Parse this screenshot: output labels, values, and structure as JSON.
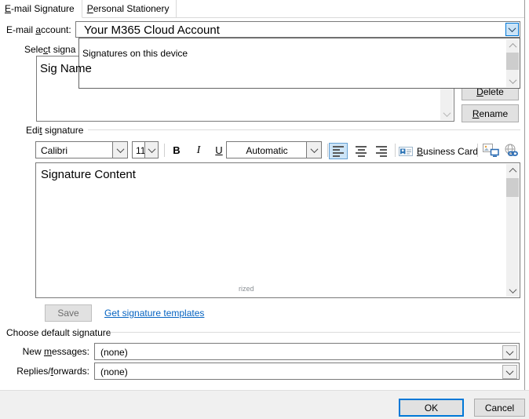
{
  "tabs": [
    {
      "pre": "",
      "key": "E",
      "post": "-mail Signature"
    },
    {
      "pre": "",
      "key": "P",
      "post": "ersonal Stationery"
    }
  ],
  "account": {
    "label_pre": "E-mail ",
    "label_key": "a",
    "label_post": "ccount:",
    "value": "Your M365 Cloud Account",
    "dropdown_item": "Signatures on this device"
  },
  "signature_list": {
    "label_pre": "Sele",
    "label_key": "c",
    "label_post": "t signa",
    "item": "Sig Name"
  },
  "side_buttons": {
    "delete_pre": "",
    "delete_key": "D",
    "delete_post": "elete",
    "rename_pre": "",
    "rename_key": "R",
    "rename_post": "ename"
  },
  "edit_signature": {
    "label_pre": "Edi",
    "label_key": "t",
    "label_post": " signature",
    "font_name": "Calibri",
    "font_size": "11",
    "bold": "B",
    "italic": "I",
    "underline": "U",
    "font_color": "Automatic",
    "business_card_pre": "",
    "business_card_key": "B",
    "business_card_post": "usiness Card",
    "content": "Signature Content",
    "watermark": "rized",
    "save": "Save",
    "templates_link": "Get signature templates"
  },
  "defaults": {
    "label": "Choose default signature",
    "new_messages_pre": "New ",
    "new_messages_key": "m",
    "new_messages_post": "essages:",
    "new_messages_value": "(none)",
    "replies_pre": "Replies/",
    "replies_key": "f",
    "replies_post": "orwards:",
    "replies_value": "(none)"
  },
  "footer": {
    "ok": "OK",
    "cancel": "Cancel"
  },
  "colors": {
    "accent": "#0078d7",
    "selection_fill": "#cce4f7",
    "link": "#0563c1",
    "button_face": "#e1e1e1",
    "footer_bg": "#f0f0f0"
  },
  "icons": {
    "combo_button": "chevron-down-icon",
    "alignment": [
      "align-left-icon",
      "align-center-icon",
      "align-right-icon"
    ],
    "business_card": "business-card-icon",
    "picture": "insert-picture-icon",
    "hyperlink": "insert-hyperlink-icon",
    "scrollbar": [
      "scroll-up-icon",
      "scroll-down-icon"
    ]
  }
}
